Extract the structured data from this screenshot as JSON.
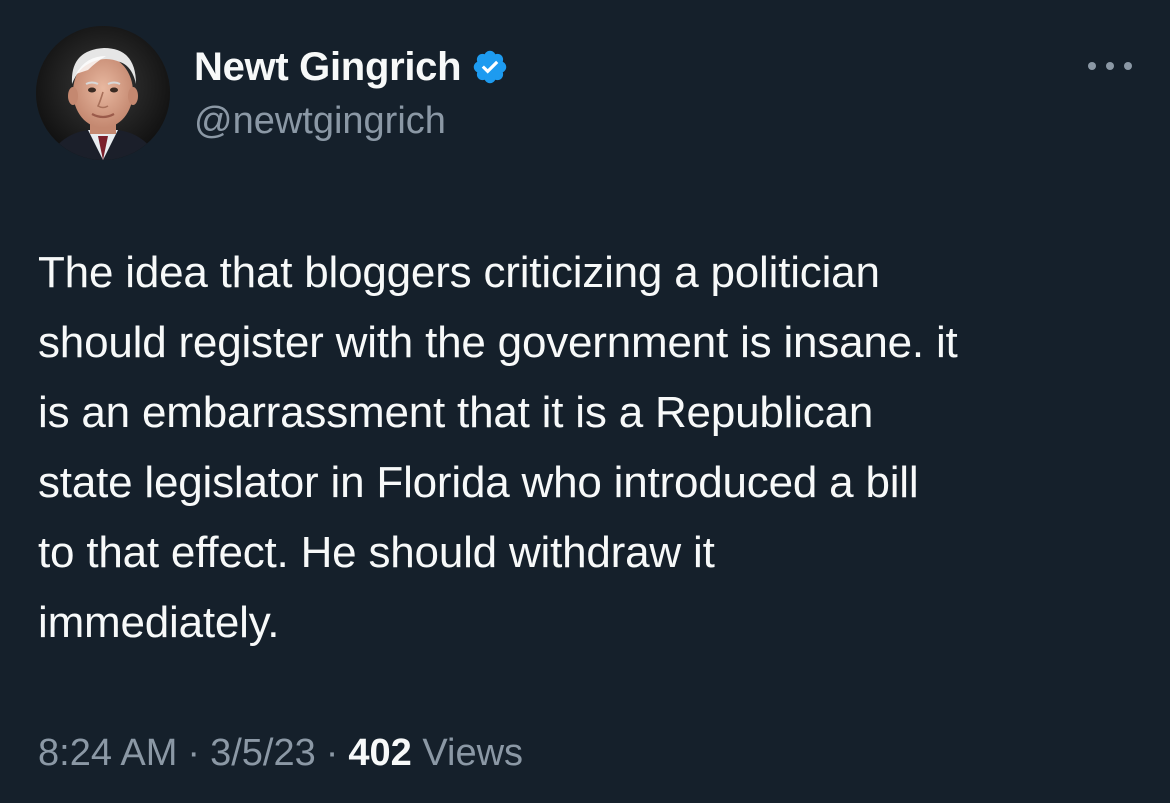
{
  "author": {
    "display_name": "Newt Gingrich",
    "handle": "@newtgingrich",
    "verified": true,
    "verified_color": "#1d9bf0"
  },
  "more_menu_icon": "ellipsis-horizontal-icon",
  "tweet": {
    "text": "The idea that bloggers criticizing a politician\nshould register with the government is insane. it\nis an embarrassment that it is a Republican\nstate legislator in Florida who introduced a bill\nto that effect. He should withdraw it\nimmediately."
  },
  "meta": {
    "time": "8:24 AM",
    "separator": "·",
    "date": "3/5/23",
    "views_count": "402",
    "views_label": "Views"
  },
  "colors": {
    "background": "#15202b",
    "primary_text": "#f7f9f9",
    "secondary_text": "#8b98a5"
  }
}
